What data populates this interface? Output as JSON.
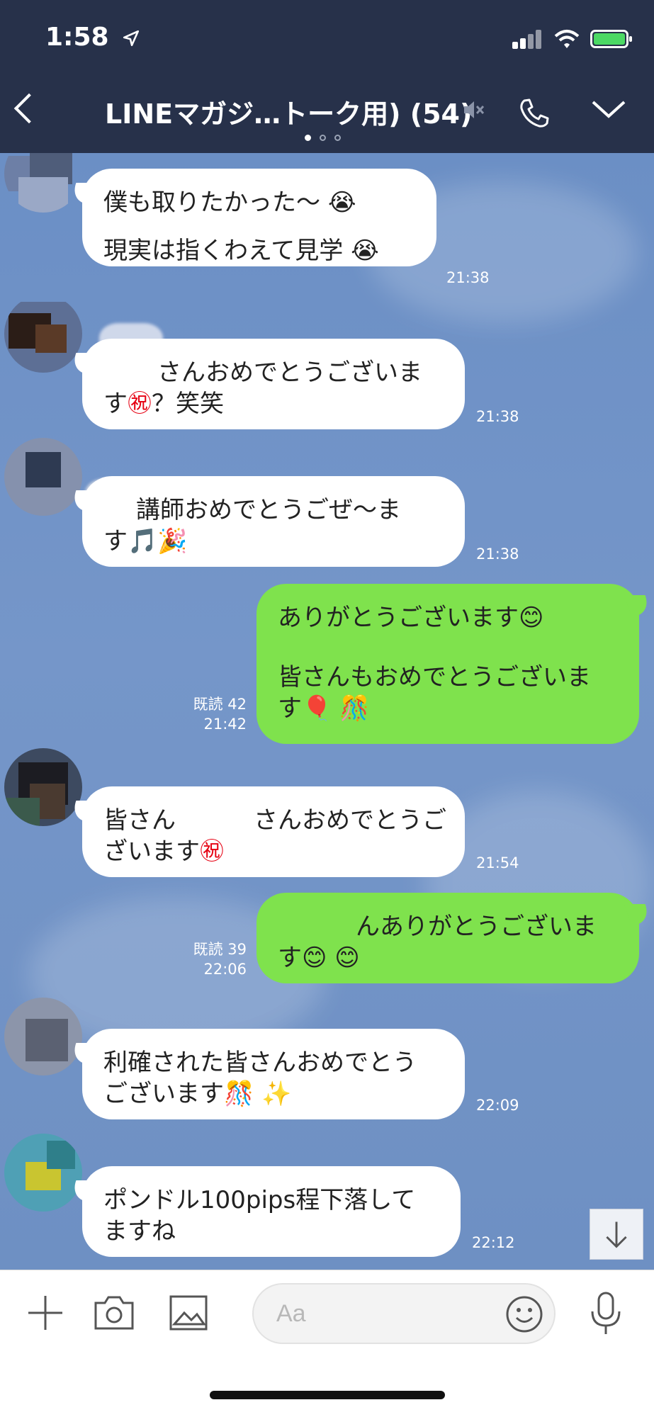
{
  "status_bar": {
    "time": "1:58"
  },
  "header": {
    "title": "LINEマガジ…トーク用) (54)",
    "page_indicator": {
      "count": 3,
      "active": 0
    }
  },
  "messages": [
    {
      "side": "in",
      "lines": [
        "僕も取りたかった〜",
        "現実は指くわえて見学"
      ],
      "emoji": [
        "😭",
        "😭"
      ],
      "time": "21:38"
    },
    {
      "side": "in",
      "lines": [
        "さんおめでとうございま",
        "す",
        "？笑笑"
      ],
      "emoji": [
        "㊗"
      ],
      "time": "21:38"
    },
    {
      "side": "in",
      "lines": [
        "講師おめでとうごぜ〜ま",
        "す"
      ],
      "emoji": [
        "🎵",
        "🎉"
      ],
      "time": "21:38"
    },
    {
      "side": "out",
      "lines": [
        "ありがとうございます",
        "皆さんもおめでとうございま",
        "す"
      ],
      "emoji": [
        "😊",
        "🎈",
        "🎊"
      ],
      "read": "既読 42",
      "time": "21:42"
    },
    {
      "side": "in",
      "lines": [
        "皆さん",
        "さんおめでとうご",
        "ざいます"
      ],
      "emoji": [
        "㊗"
      ],
      "time": "21:54"
    },
    {
      "side": "out",
      "lines": [
        "んありがとうございま",
        "す"
      ],
      "emoji": [
        "😊",
        "😊"
      ],
      "read": "既読 39",
      "time": "22:06"
    },
    {
      "side": "in",
      "lines": [
        "利確された皆さんおめでとう",
        "ございます"
      ],
      "emoji": [
        "🎊",
        "✨"
      ],
      "time": "22:09"
    },
    {
      "side": "in",
      "lines": [
        "ポンドル100pips程下落して",
        "ますね"
      ],
      "time": "22:12"
    }
  ],
  "input": {
    "placeholder": "Aa"
  },
  "colors": {
    "header_bg": "#27314a",
    "chat_bg": "#7596c9",
    "outgoing_bubble": "#7fe24d",
    "incoming_bubble": "#ffffff",
    "battery": "#4cd964"
  },
  "icons": [
    "location-arrow-icon",
    "signal-icon",
    "wifi-icon",
    "battery-icon",
    "back-icon",
    "mute-icon",
    "phone-icon",
    "chevron-down-icon",
    "plus-icon",
    "camera-icon",
    "image-icon",
    "emoji-icon",
    "mic-icon",
    "arrow-down-icon"
  ]
}
